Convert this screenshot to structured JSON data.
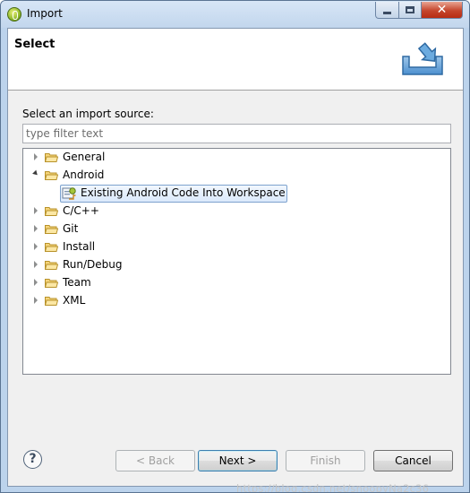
{
  "window": {
    "title": "Import",
    "controls": {
      "minimize": "minimize",
      "maximize": "maximize",
      "close": "close"
    }
  },
  "header": {
    "title": "Select",
    "icon": "import-wizard-icon"
  },
  "main": {
    "source_label": "Select an import source:",
    "filter_placeholder": "type filter text",
    "filter_value": "",
    "tree": [
      {
        "label": "General",
        "expanded": false,
        "icon": "folder-icon"
      },
      {
        "label": "Android",
        "expanded": true,
        "icon": "folder-icon",
        "children": [
          {
            "label": "Existing Android Code Into Workspace",
            "icon": "android-project-icon",
            "selected": true
          }
        ]
      },
      {
        "label": "C/C++",
        "expanded": false,
        "icon": "folder-icon"
      },
      {
        "label": "Git",
        "expanded": false,
        "icon": "folder-icon"
      },
      {
        "label": "Install",
        "expanded": false,
        "icon": "folder-icon"
      },
      {
        "label": "Run/Debug",
        "expanded": false,
        "icon": "folder-icon"
      },
      {
        "label": "Team",
        "expanded": false,
        "icon": "folder-icon"
      },
      {
        "label": "XML",
        "expanded": false,
        "icon": "folder-icon"
      }
    ]
  },
  "footer": {
    "help": "?",
    "back_label": "< Back",
    "next_label": "Next >",
    "finish_label": "Finish",
    "cancel_label": "Cancel"
  },
  "watermark": "https://blog.csdn.net/snoopyNa2c36"
}
